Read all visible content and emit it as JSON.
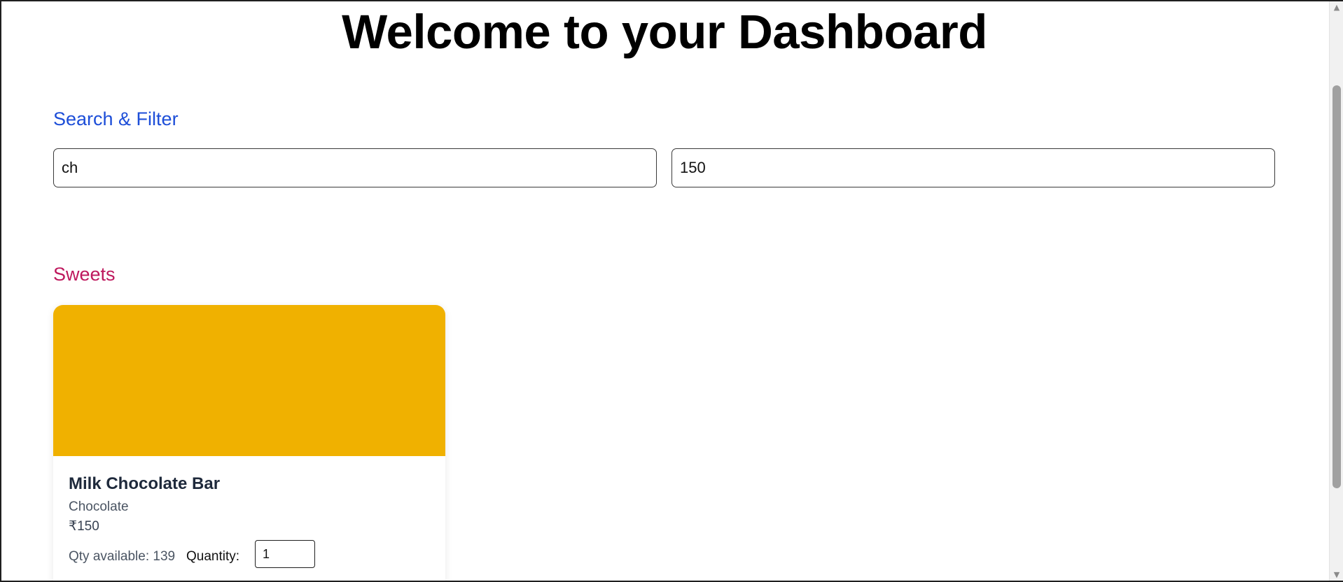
{
  "header": {
    "title": "Welcome to your Dashboard"
  },
  "search_filter": {
    "heading": "Search & Filter",
    "name_search_value": "ch",
    "price_filter_value": "150"
  },
  "sweets": {
    "heading": "Sweets",
    "items": [
      {
        "name": "Milk Chocolate Bar",
        "category": "Chocolate",
        "price": "₹150",
        "qty_available": "Qty available: 139",
        "quantity_label": "Quantity:",
        "quantity_value": "1",
        "image_color": "#f0b100"
      }
    ]
  },
  "colors": {
    "search_heading": "#1d4ed8",
    "sweets_heading": "#be185d",
    "card_image": "#f0b100"
  },
  "scrollbar": {
    "up_icon": "triangle-up-icon",
    "down_icon": "triangle-down-icon"
  }
}
